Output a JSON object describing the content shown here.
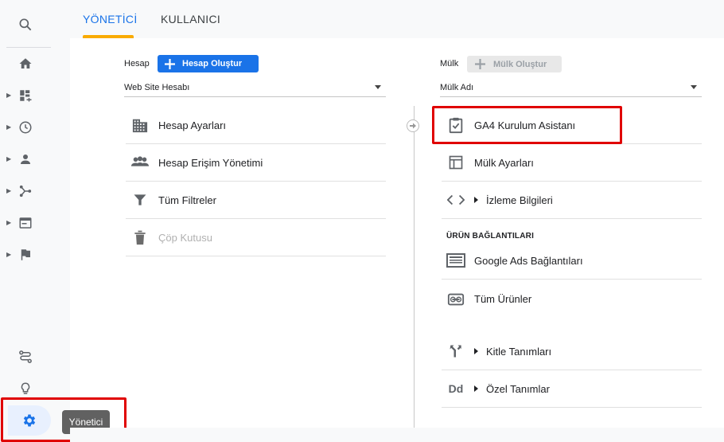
{
  "tabs": [
    {
      "label": "YÖNETİCİ",
      "active": true
    },
    {
      "label": "KULLANICI",
      "active": false
    }
  ],
  "tooltip": "Yönetici",
  "account": {
    "label": "Hesap",
    "create_button": "Hesap Oluştur",
    "select_value": "Web Site Hesabı",
    "items": [
      {
        "label": "Hesap Ayarları",
        "icon": "building-icon",
        "disabled": false
      },
      {
        "label": "Hesap Erişim Yönetimi",
        "icon": "people-icon",
        "disabled": false
      },
      {
        "label": "Tüm Filtreler",
        "icon": "filter-icon",
        "disabled": false
      },
      {
        "label": "Çöp Kutusu",
        "icon": "trash-icon",
        "disabled": true
      }
    ]
  },
  "property": {
    "label": "Mülk",
    "create_button": "Mülk Oluştur",
    "select_value": "Mülk Adı",
    "items": [
      {
        "label": "GA4 Kurulum Asistanı",
        "icon": "checklist-icon"
      },
      {
        "label": "Mülk Ayarları",
        "icon": "layout-icon"
      },
      {
        "label": "İzleme Bilgileri",
        "icon": "code-icon",
        "expandable": true
      }
    ],
    "section_title": "ÜRÜN BAĞLANTILARI",
    "link_items": [
      {
        "label": "Google Ads Bağlantıları",
        "icon": "ads-icon"
      },
      {
        "label": "Tüm Ürünler",
        "icon": "link-icon"
      }
    ],
    "def_items": [
      {
        "label": "Kitle Tanımları",
        "icon": "fork-icon",
        "expandable": true
      },
      {
        "label": "Özel Tanımlar",
        "icon": "dd-icon",
        "expandable": true,
        "icon_text": "Dd"
      }
    ]
  },
  "colors": {
    "accent": "#1a73e8",
    "highlight": "#e00000",
    "tab_underline": "#f9ab00"
  }
}
